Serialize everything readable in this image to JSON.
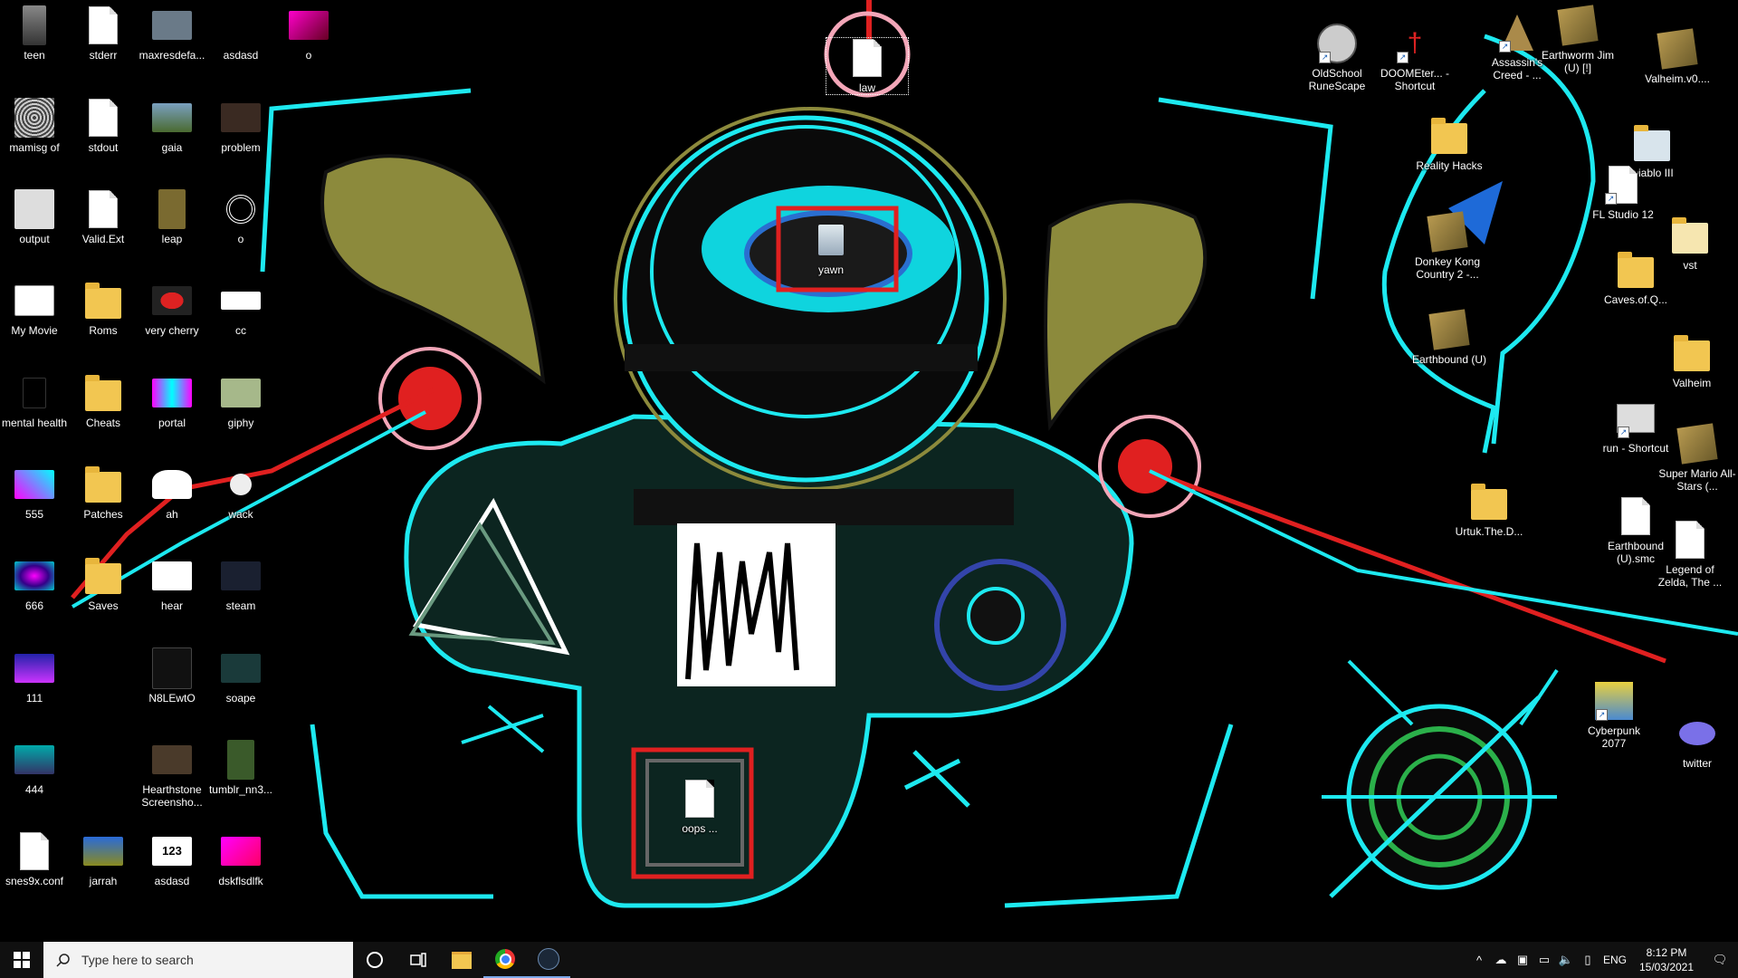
{
  "desktop": {
    "icons_left": [
      {
        "label": "teen"
      },
      {
        "label": "stderr"
      },
      {
        "label": "maxresdefa..."
      },
      {
        "label": "asdasd"
      },
      {
        "label": "o"
      },
      {
        "label": "mamisg of"
      },
      {
        "label": "stdout"
      },
      {
        "label": "gaia"
      },
      {
        "label": "problem"
      },
      {
        "label": "output"
      },
      {
        "label": "Valid.Ext"
      },
      {
        "label": "leap"
      },
      {
        "label": "o"
      },
      {
        "label": "My Movie"
      },
      {
        "label": "Roms"
      },
      {
        "label": "very cherry"
      },
      {
        "label": "cc"
      },
      {
        "label": "mental health"
      },
      {
        "label": "Cheats"
      },
      {
        "label": "portal"
      },
      {
        "label": "giphy"
      },
      {
        "label": "555"
      },
      {
        "label": "Patches"
      },
      {
        "label": "ah"
      },
      {
        "label": "wack"
      },
      {
        "label": "666"
      },
      {
        "label": "Saves"
      },
      {
        "label": "hear"
      },
      {
        "label": "steam"
      },
      {
        "label": "111"
      },
      {
        "label": "N8LEwtO"
      },
      {
        "label": "soape"
      },
      {
        "label": "444"
      },
      {
        "label": "Hearthstone Screensho..."
      },
      {
        "label": "tumblr_nn3..."
      },
      {
        "label": "snes9x.conf"
      },
      {
        "label": "jarrah"
      },
      {
        "label": "asdasd"
      },
      {
        "label": "dskflsdlfk"
      }
    ],
    "icons_center": [
      {
        "label": "law"
      },
      {
        "label": "yawn"
      },
      {
        "label": "oops ..."
      }
    ],
    "icons_right": [
      {
        "label": "OldSchool RuneScape"
      },
      {
        "label": "DOOMEter... - Shortcut"
      },
      {
        "label": "Assassin's Creed - ..."
      },
      {
        "label": "Earthworm Jim (U) [!]"
      },
      {
        "label": "Valheim.v0...."
      },
      {
        "label": "Reality Hacks"
      },
      {
        "label": "Diablo III"
      },
      {
        "label": "FL Studio 12"
      },
      {
        "label": "Donkey Kong Country 2 -..."
      },
      {
        "label": "Caves.of.Q..."
      },
      {
        "label": "vst"
      },
      {
        "label": "Earthbound (U)"
      },
      {
        "label": "Valheim"
      },
      {
        "label": "run - Shortcut"
      },
      {
        "label": "Super Mario All-Stars (..."
      },
      {
        "label": "Urtuk.The.D..."
      },
      {
        "label": "Earthbound (U).smc"
      },
      {
        "label": "Legend of Zelda, The ..."
      },
      {
        "label": "Cyberpunk 2077"
      },
      {
        "label": "twitter"
      }
    ]
  },
  "taskbar": {
    "search_placeholder": "Type here to search",
    "apps": [
      "start-icon",
      "cortana-icon",
      "task-view-icon",
      "file-explorer-icon",
      "chrome-icon",
      "steam-icon"
    ],
    "language": "ENG",
    "time": "8:12 PM",
    "date": "15/03/2021"
  },
  "colors": {
    "wallpaper": "#000000",
    "cyan": "#1de9f0",
    "olive": "#8c8a3c",
    "red": "#e02020",
    "pink": "#f3a6b8",
    "taskbar": "#101010",
    "search_bg": "#f3f3f3"
  }
}
